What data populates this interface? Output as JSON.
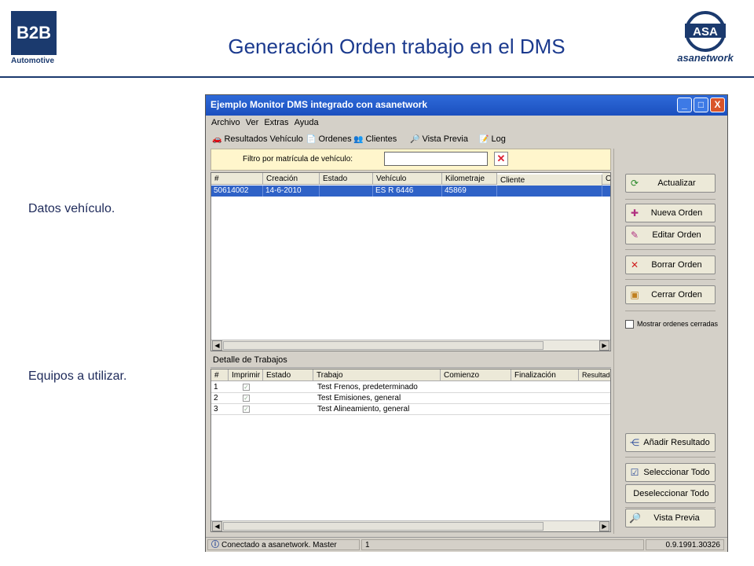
{
  "slide": {
    "title": "Generación Orden trabajo en el DMS",
    "logo_left_main": "B2B",
    "logo_left_sub": "Automotive",
    "logo_right_mark": "ASA",
    "logo_right_sub": "asanetwork",
    "label_vehicle": "Datos vehículo.",
    "label_equipment": "Equipos a utilizar.",
    "brand_color": "#1b3a6e",
    "title_color": "#1b3a8e"
  },
  "window": {
    "title": "Ejemplo Monitor DMS integrado con asanetwork",
    "controls": {
      "minimize": "_",
      "maximize": "□",
      "close": "X"
    }
  },
  "menu": [
    "Archivo",
    "Ver",
    "Extras",
    "Ayuda"
  ],
  "tabs": [
    {
      "label": "Resultados Vehículo",
      "icon": "car-icon"
    },
    {
      "label": "Ordenes",
      "icon": "document-icon"
    },
    {
      "label": "Clientes",
      "icon": "people-icon"
    },
    {
      "label": "Vista Previa",
      "icon": "preview-icon"
    },
    {
      "label": "Log",
      "icon": "log-icon"
    }
  ],
  "filter": {
    "label": "Filtro por matrícula de vehículo:",
    "value": ""
  },
  "vehicle_grid": {
    "columns": [
      "#",
      "Creación",
      "Estado",
      "Vehículo",
      "Kilometraje",
      "Cliente",
      "O"
    ],
    "rows": [
      {
        "id": "50614002",
        "created": "14-6-2010",
        "status": "",
        "vehicle": "ES R 6446",
        "km": "45869",
        "client": ""
      }
    ]
  },
  "detail": {
    "title": "Detalle de Trabajos",
    "columns": [
      "#",
      "Imprimir",
      "Estado",
      "Trabajo",
      "Comienzo",
      "Finalización",
      "Resultado"
    ],
    "rows": [
      {
        "n": "1",
        "job": "Test Frenos, predeterminado"
      },
      {
        "n": "2",
        "job": "Test Emisiones, general"
      },
      {
        "n": "3",
        "job": "Test Alineamiento, general"
      }
    ]
  },
  "buttons": {
    "refresh": "Actualizar",
    "new_order": "Nueva Orden",
    "edit_order": "Editar Orden",
    "delete_order": "Borrar Orden",
    "close_order": "Cerrar Orden",
    "show_closed": "Mostrar ordenes cerradas",
    "add_result": "Añadir Resultado",
    "select_all": "Seleccionar Todo",
    "deselect_all": "Deseleccionar Todo",
    "preview": "Vista Previa"
  },
  "status": {
    "message": "Conectado a asanetwork. Master",
    "count": "1",
    "version": "0.9.1991.30326"
  }
}
